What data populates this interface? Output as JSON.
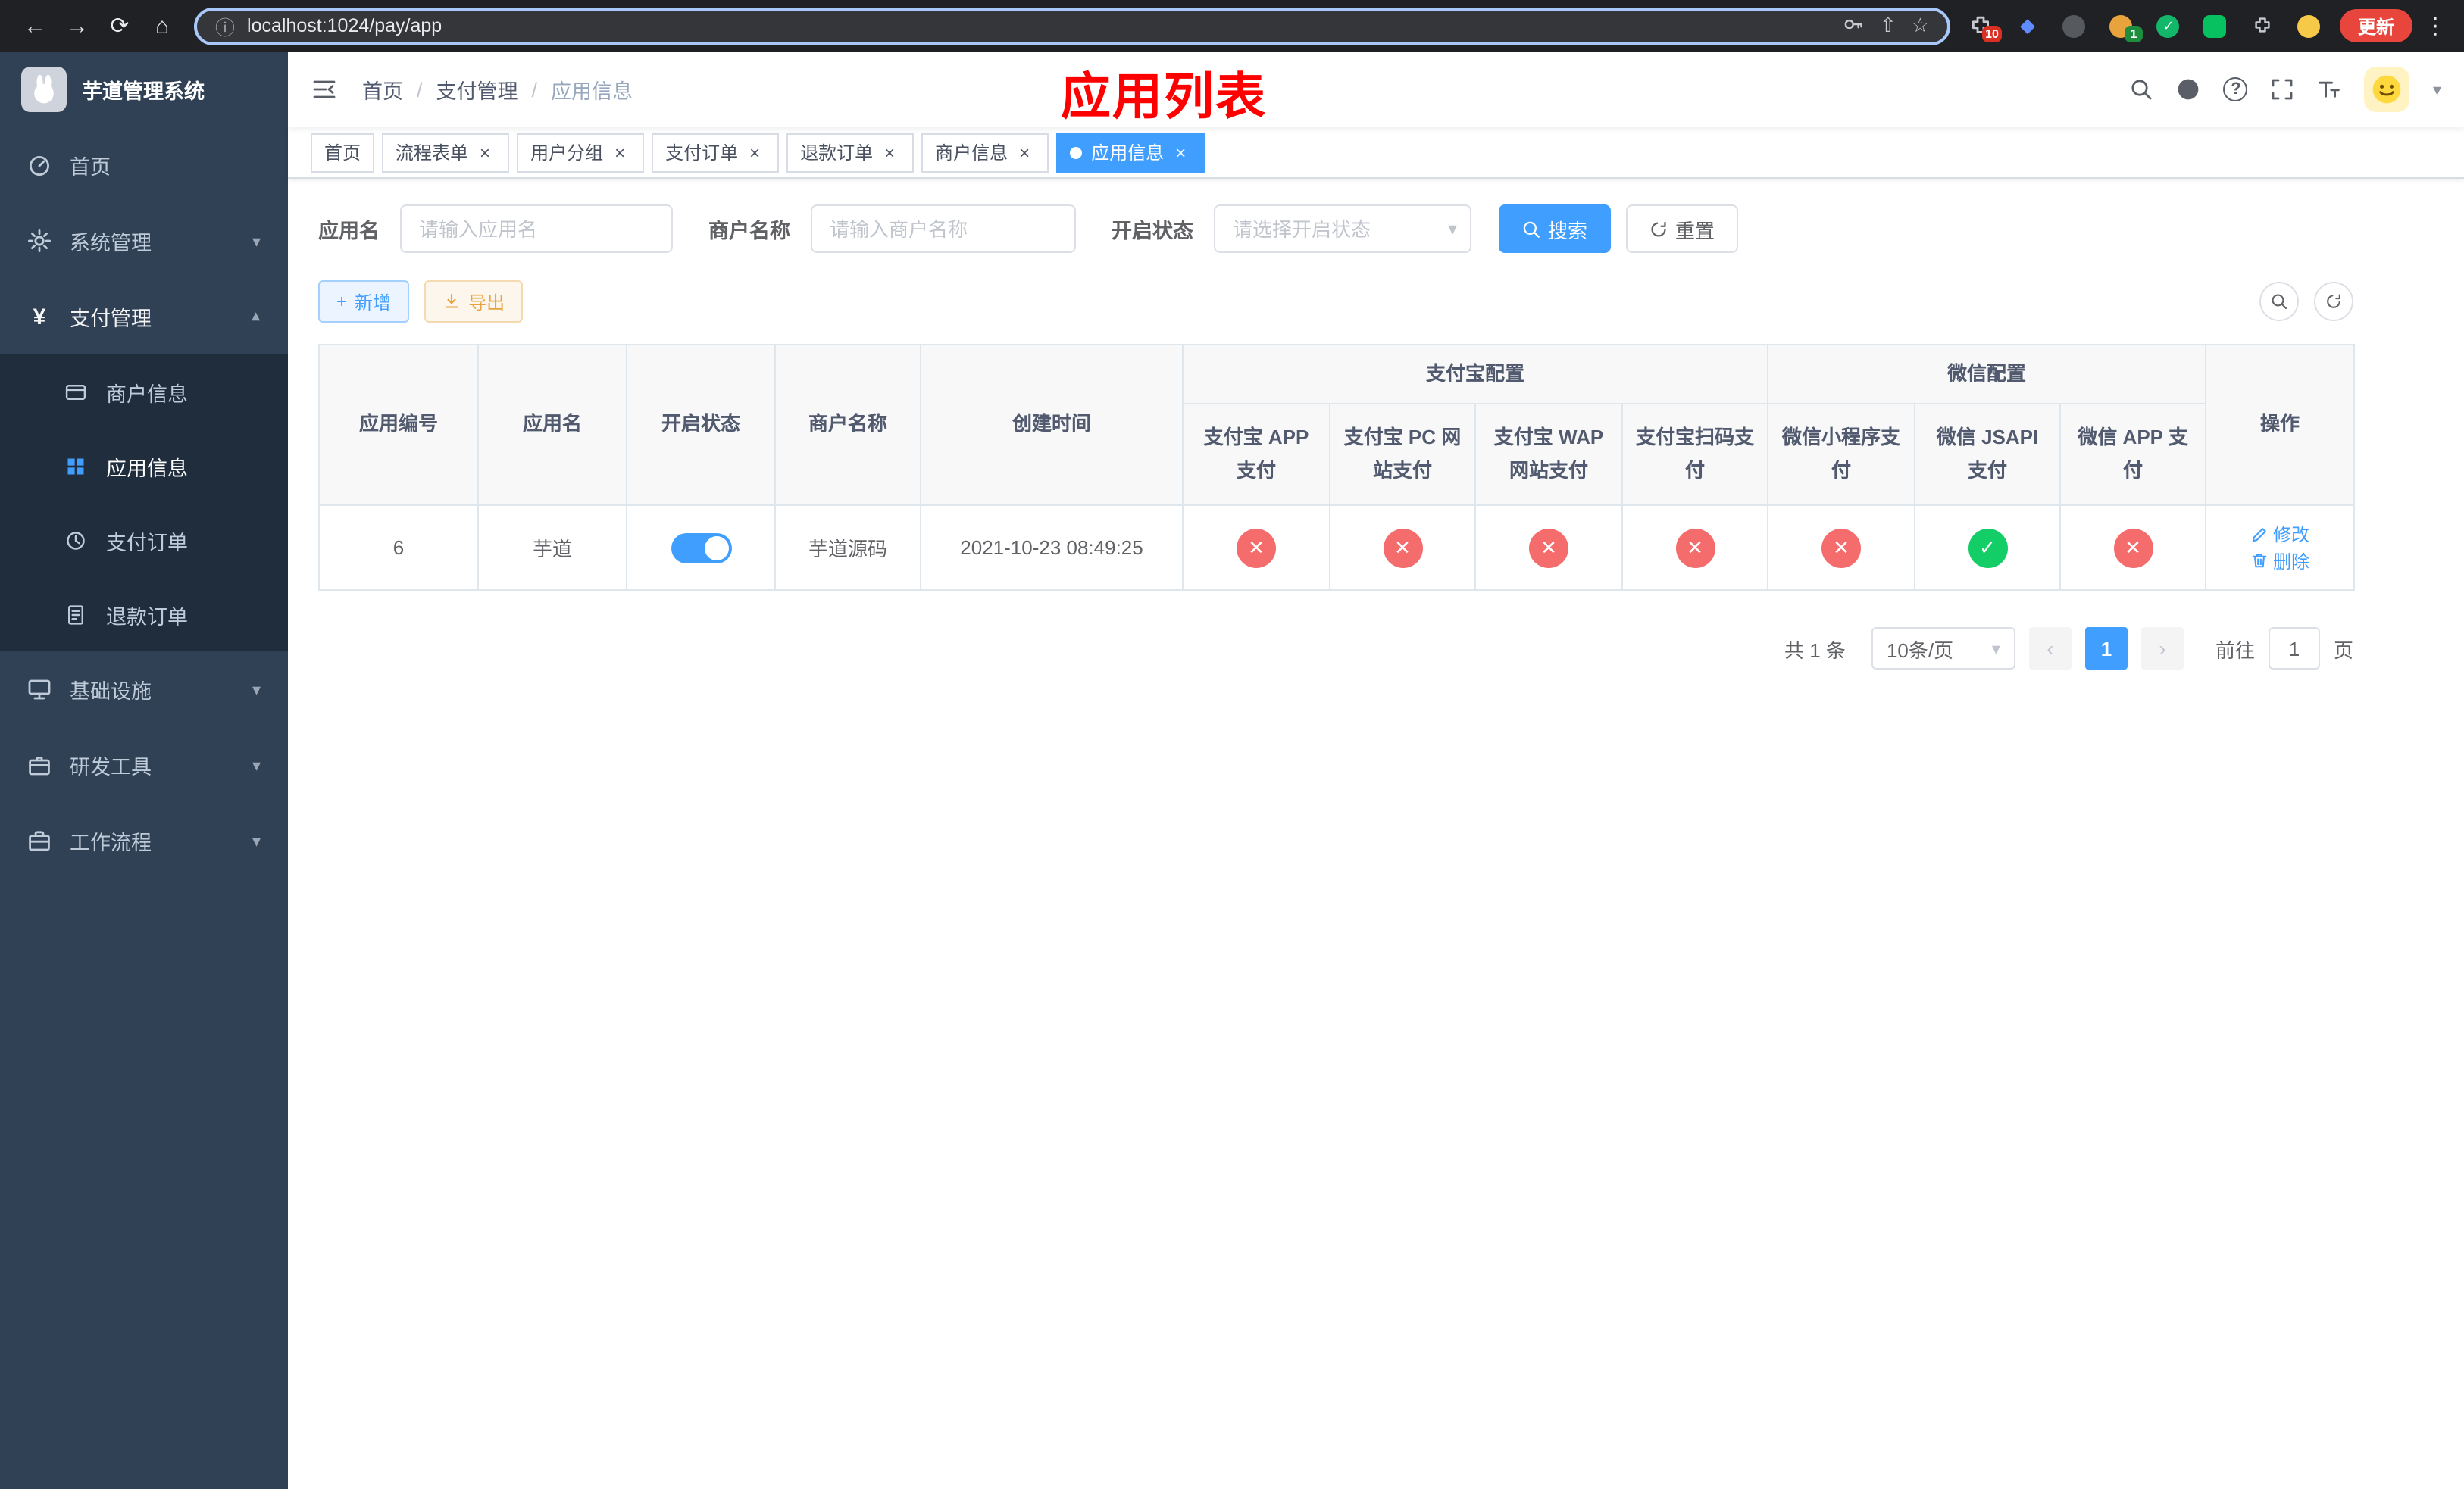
{
  "glyphs": {
    "close": "×",
    "check": "✓",
    "cross": "✕",
    "separator": "/",
    "back": "←",
    "forward": "→",
    "reload": "⟳",
    "home": "⌂",
    "info": "ⓘ",
    "share": "⇧",
    "star": "☆",
    "kebab": "⋮",
    "caret_down": "▾",
    "prev": "‹",
    "next": "›",
    "plus": "+",
    "yen": "¥",
    "question": "?",
    "diamond": "◆"
  },
  "colors": {
    "primary": "#409eff",
    "success": "#13ce66",
    "danger": "#f56c6c",
    "warning": "#e6a23c",
    "sidebar_bg": "#304156",
    "submenu_bg": "#1f2d3d",
    "annotation_red": "#ff0000"
  },
  "browser": {
    "url": "localhost:1024/pay/app",
    "update_label": "更新",
    "extensions_badge": "10",
    "profile_badge": "1"
  },
  "sidebar": {
    "app_title": "芋道管理系统",
    "menu": [
      {
        "label": "首页"
      },
      {
        "label": "系统管理"
      },
      {
        "label": "支付管理"
      },
      {
        "label": "基础设施"
      },
      {
        "label": "研发工具"
      },
      {
        "label": "工作流程"
      }
    ],
    "submenu": [
      {
        "label": "商户信息"
      },
      {
        "label": "应用信息"
      },
      {
        "label": "支付订单"
      },
      {
        "label": "退款订单"
      }
    ]
  },
  "header": {
    "breadcrumb": [
      "首页",
      "支付管理",
      "应用信息"
    ],
    "overlay_title": "应用列表"
  },
  "tabs": [
    {
      "label": "首页"
    },
    {
      "label": "流程表单"
    },
    {
      "label": "用户分组"
    },
    {
      "label": "支付订单"
    },
    {
      "label": "退款订单"
    },
    {
      "label": "商户信息"
    },
    {
      "label": "应用信息"
    }
  ],
  "filters": {
    "app_name_label": "应用名",
    "app_name_placeholder": "请输入应用名",
    "merchant_label": "商户名称",
    "merchant_placeholder": "请输入商户名称",
    "status_label": "开启状态",
    "status_placeholder": "请选择开启状态",
    "search_label": "搜索",
    "reset_label": "重置"
  },
  "toolbar": {
    "add_label": "新增",
    "export_label": "导出"
  },
  "table": {
    "columns": {
      "app_id": "应用编号",
      "app_name": "应用名",
      "status": "开启状态",
      "merchant": "商户名称",
      "created": "创建时间",
      "alipay_group": "支付宝配置",
      "alipay_app": "支付宝 APP 支付",
      "alipay_pc": "支付宝 PC 网站支付",
      "alipay_wap": "支付宝 WAP 网站支付",
      "alipay_qr": "支付宝扫码支付",
      "wechat_group": "微信配置",
      "wechat_mini": "微信小程序支付",
      "wechat_jsapi": "微信 JSAPI 支付",
      "wechat_app": "微信 APP 支付",
      "actions": "操作"
    },
    "rows": [
      {
        "app_id": "6",
        "app_name": "芋道",
        "status_on": true,
        "merchant": "芋道源码",
        "created": "2021-10-23 08:49:25",
        "alipay_app": false,
        "alipay_pc": false,
        "alipay_wap": false,
        "alipay_qr": false,
        "wechat_mini": false,
        "wechat_jsapi": true,
        "wechat_app": false,
        "edit_label": "修改",
        "delete_label": "删除"
      }
    ]
  },
  "pagination": {
    "total_text": "共 1 条",
    "page_size": "10条/页",
    "current_page": "1",
    "goto_label": "前往",
    "goto_value": "1",
    "unit_label": "页"
  }
}
